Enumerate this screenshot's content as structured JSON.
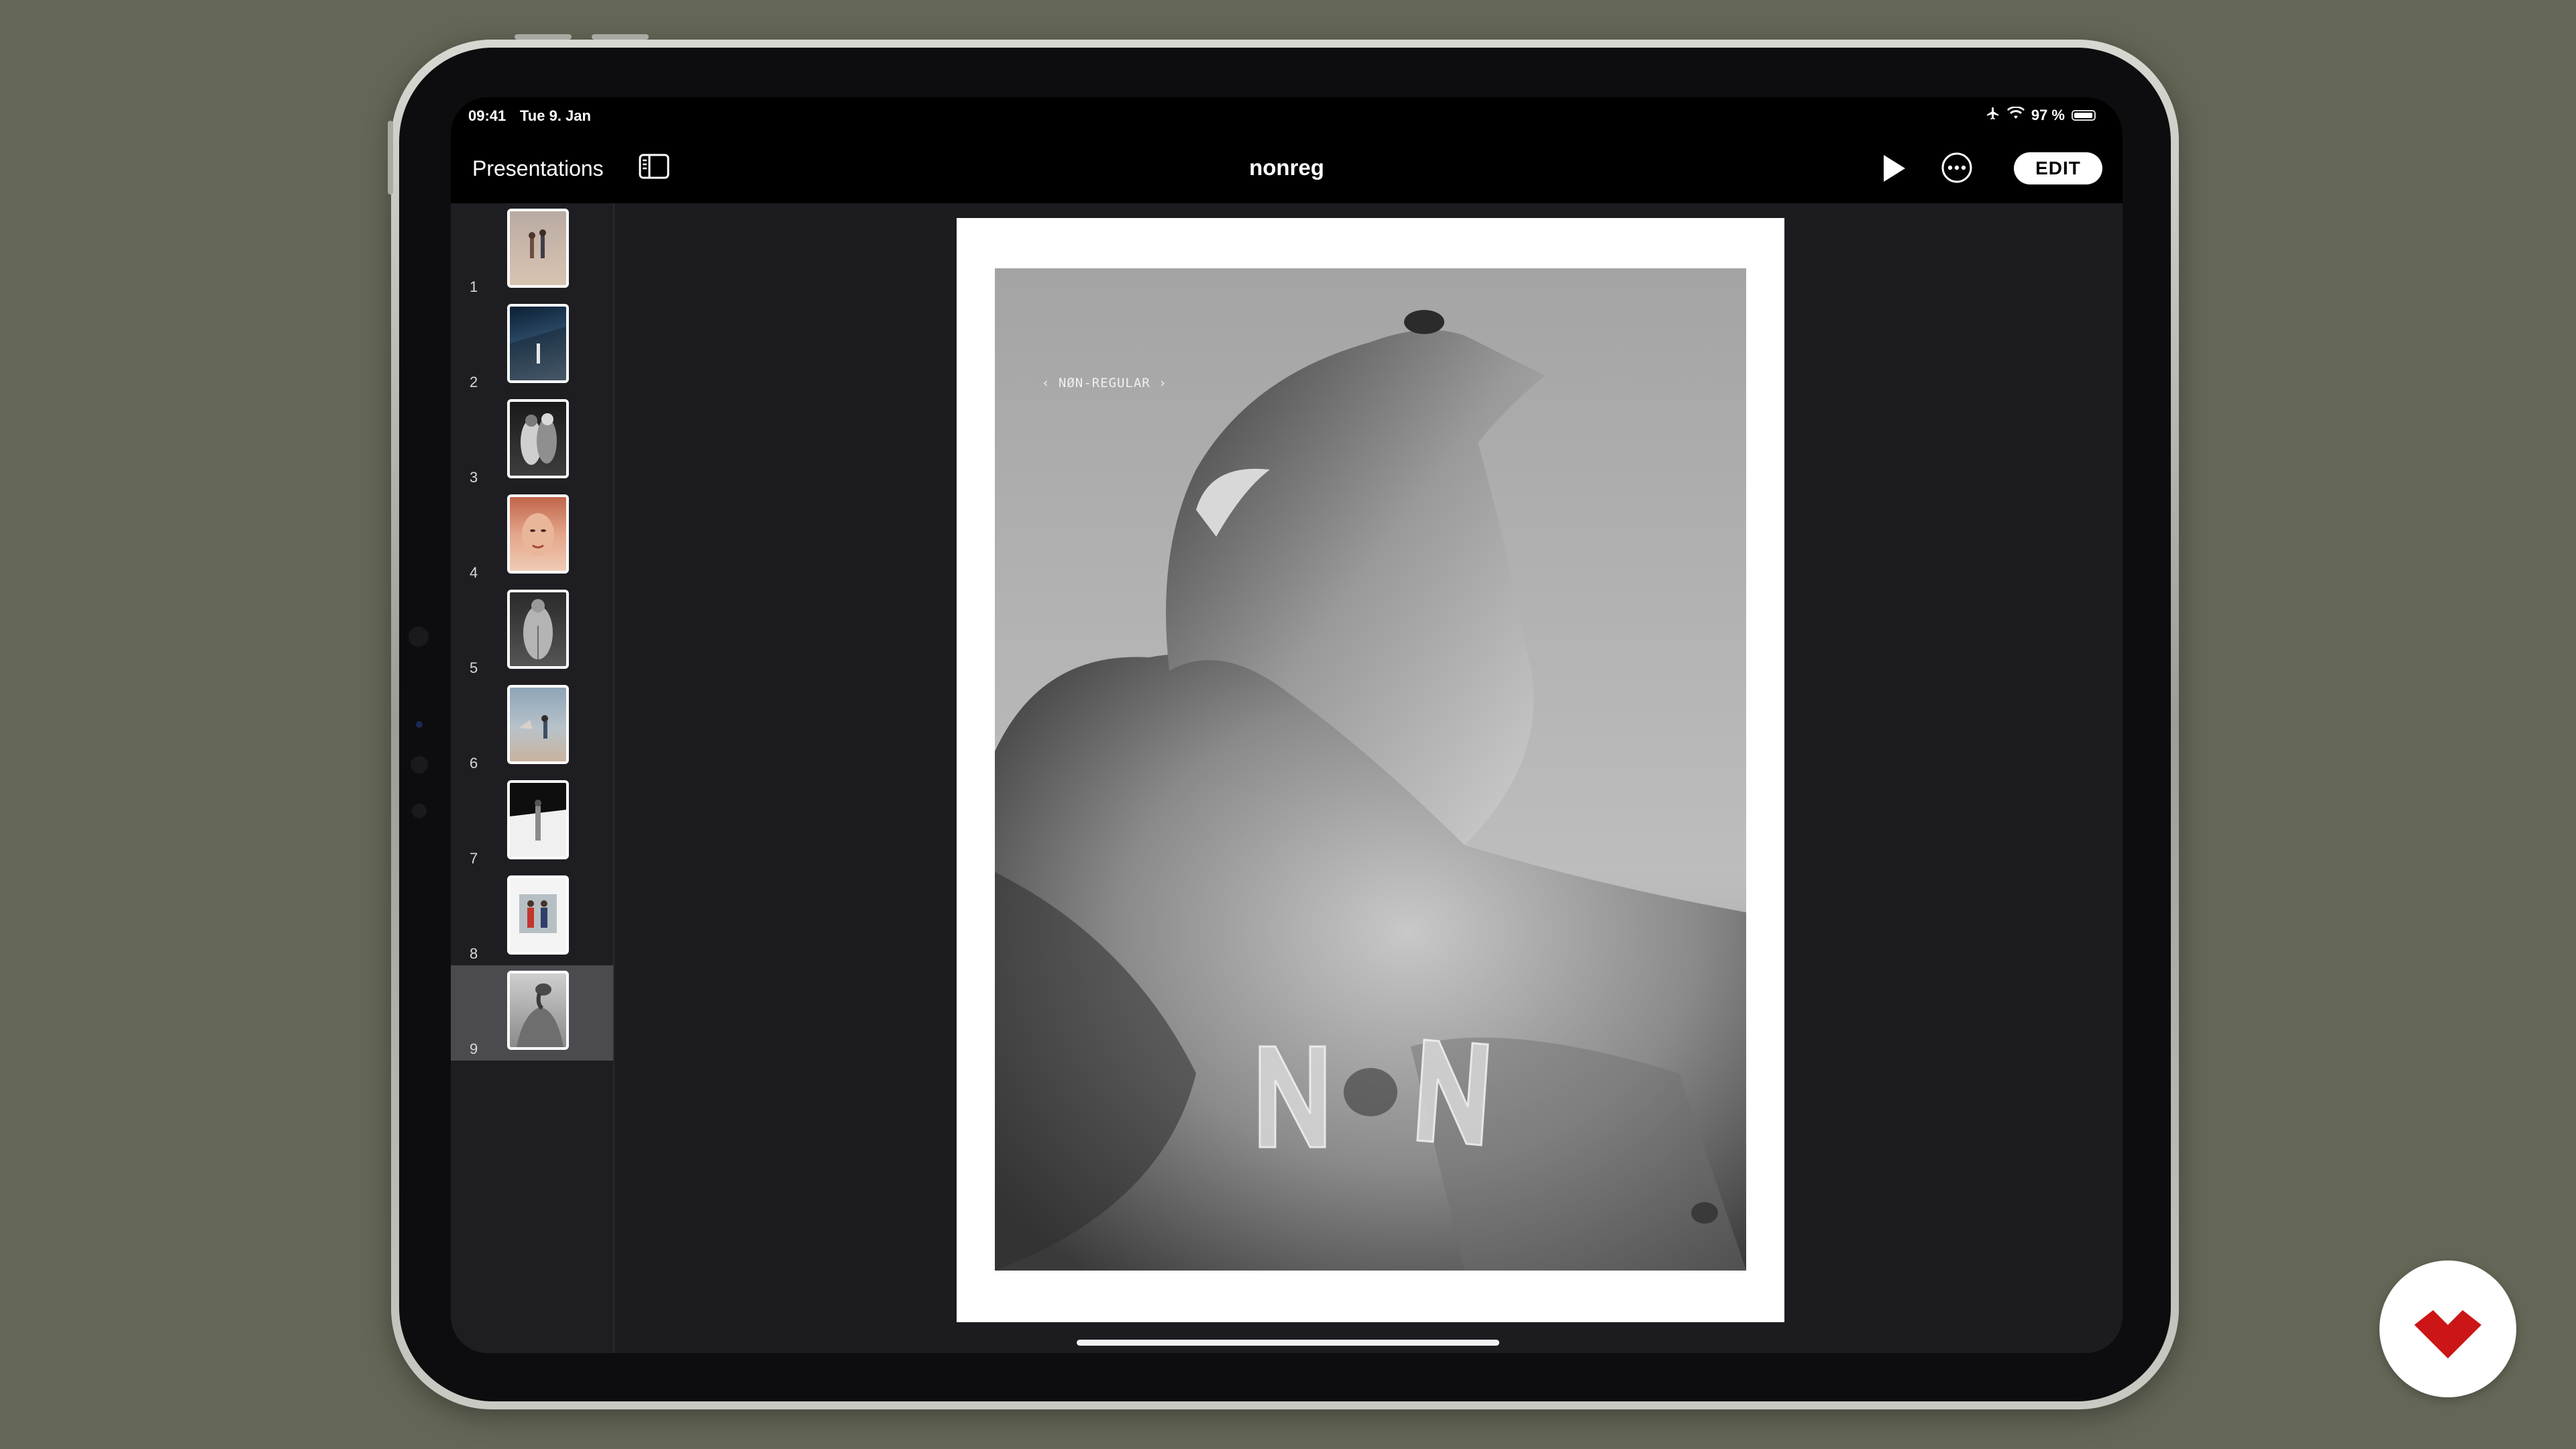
{
  "status_bar": {
    "time": "09:41",
    "date": "Tue 9. Jan",
    "battery_text": "97 %",
    "battery_level": 0.97
  },
  "nav": {
    "back_label": "Presentations",
    "title": "nonreg",
    "edit_label": "EDIT"
  },
  "slides": [
    {
      "number": "1"
    },
    {
      "number": "2"
    },
    {
      "number": "3"
    },
    {
      "number": "4"
    },
    {
      "number": "5"
    },
    {
      "number": "6"
    },
    {
      "number": "7"
    },
    {
      "number": "8"
    },
    {
      "number": "9"
    }
  ],
  "selected_slide": "9",
  "current_slide": {
    "overlay_text": "‹ NØN-REGULAR ›"
  },
  "colors": {
    "background": "#646757",
    "screen": "#1c1c20",
    "accent_badge": "#cc1517"
  }
}
